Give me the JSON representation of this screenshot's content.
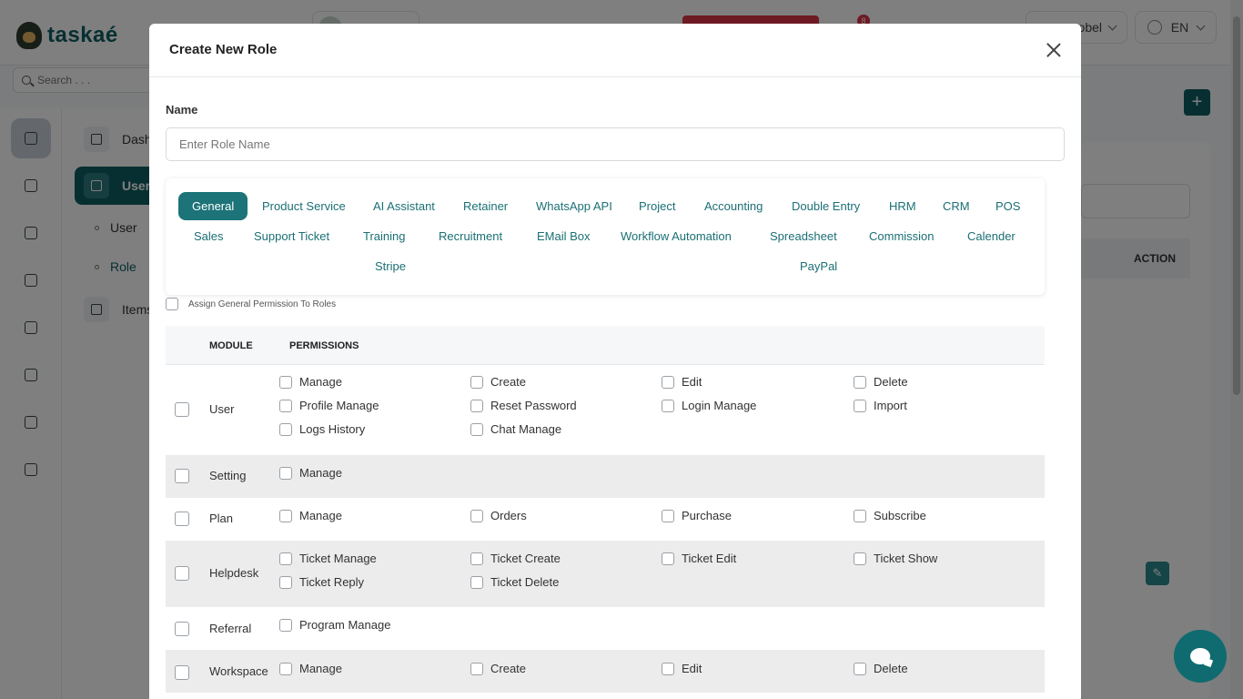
{
  "app": {
    "brand": "taskaé"
  },
  "header": {
    "user_name": "obel",
    "language": "EN",
    "notification_count": "8"
  },
  "search": {
    "placeholder": "Search . . ."
  },
  "sidebar": {
    "items": [
      {
        "label": "Dash"
      },
      {
        "label": "User"
      },
      {
        "label": "User"
      },
      {
        "label": "Role"
      },
      {
        "label": "Items"
      }
    ]
  },
  "content": {
    "action_header": "ACTION"
  },
  "modal": {
    "title": "Create New Role",
    "name_label": "Name",
    "name_placeholder": "Enter Role Name",
    "tabs": [
      "General",
      "Product Service",
      "AI Assistant",
      "Retainer",
      "WhatsApp API",
      "Project",
      "Accounting",
      "Double Entry",
      "HRM",
      "CRM",
      "POS",
      "Sales",
      "Support Ticket",
      "Training",
      "Recruitment",
      "EMail Box",
      "Workflow Automation",
      "Spreadsheet",
      "Commission",
      "Calender",
      "Stripe",
      "PayPal"
    ],
    "active_tab": "General",
    "assign_label": "Assign General Permission To Roles",
    "table": {
      "headers": [
        "MODULE",
        "PERMISSIONS"
      ],
      "rows": [
        {
          "module": "User",
          "permissions": [
            "Manage",
            "Create",
            "Edit",
            "Delete",
            "Profile Manage",
            "Reset Password",
            "Login Manage",
            "Import",
            "Logs History",
            "Chat Manage"
          ]
        },
        {
          "module": "Setting",
          "permissions": [
            "Manage"
          ]
        },
        {
          "module": "Plan",
          "permissions": [
            "Manage",
            "Orders",
            "Purchase",
            "Subscribe"
          ]
        },
        {
          "module": "Helpdesk",
          "permissions": [
            "Ticket Manage",
            "Ticket Create",
            "Ticket Edit",
            "Ticket Show",
            "Ticket Reply",
            "Ticket Delete"
          ]
        },
        {
          "module": "Referral",
          "permissions": [
            "Program Manage"
          ]
        },
        {
          "module": "Workspace",
          "permissions": [
            "Manage",
            "Create",
            "Edit",
            "Delete"
          ]
        }
      ]
    }
  },
  "colors": {
    "primary": "#0f5e63",
    "tab_active": "#1c7378",
    "danger": "#dc3545"
  }
}
